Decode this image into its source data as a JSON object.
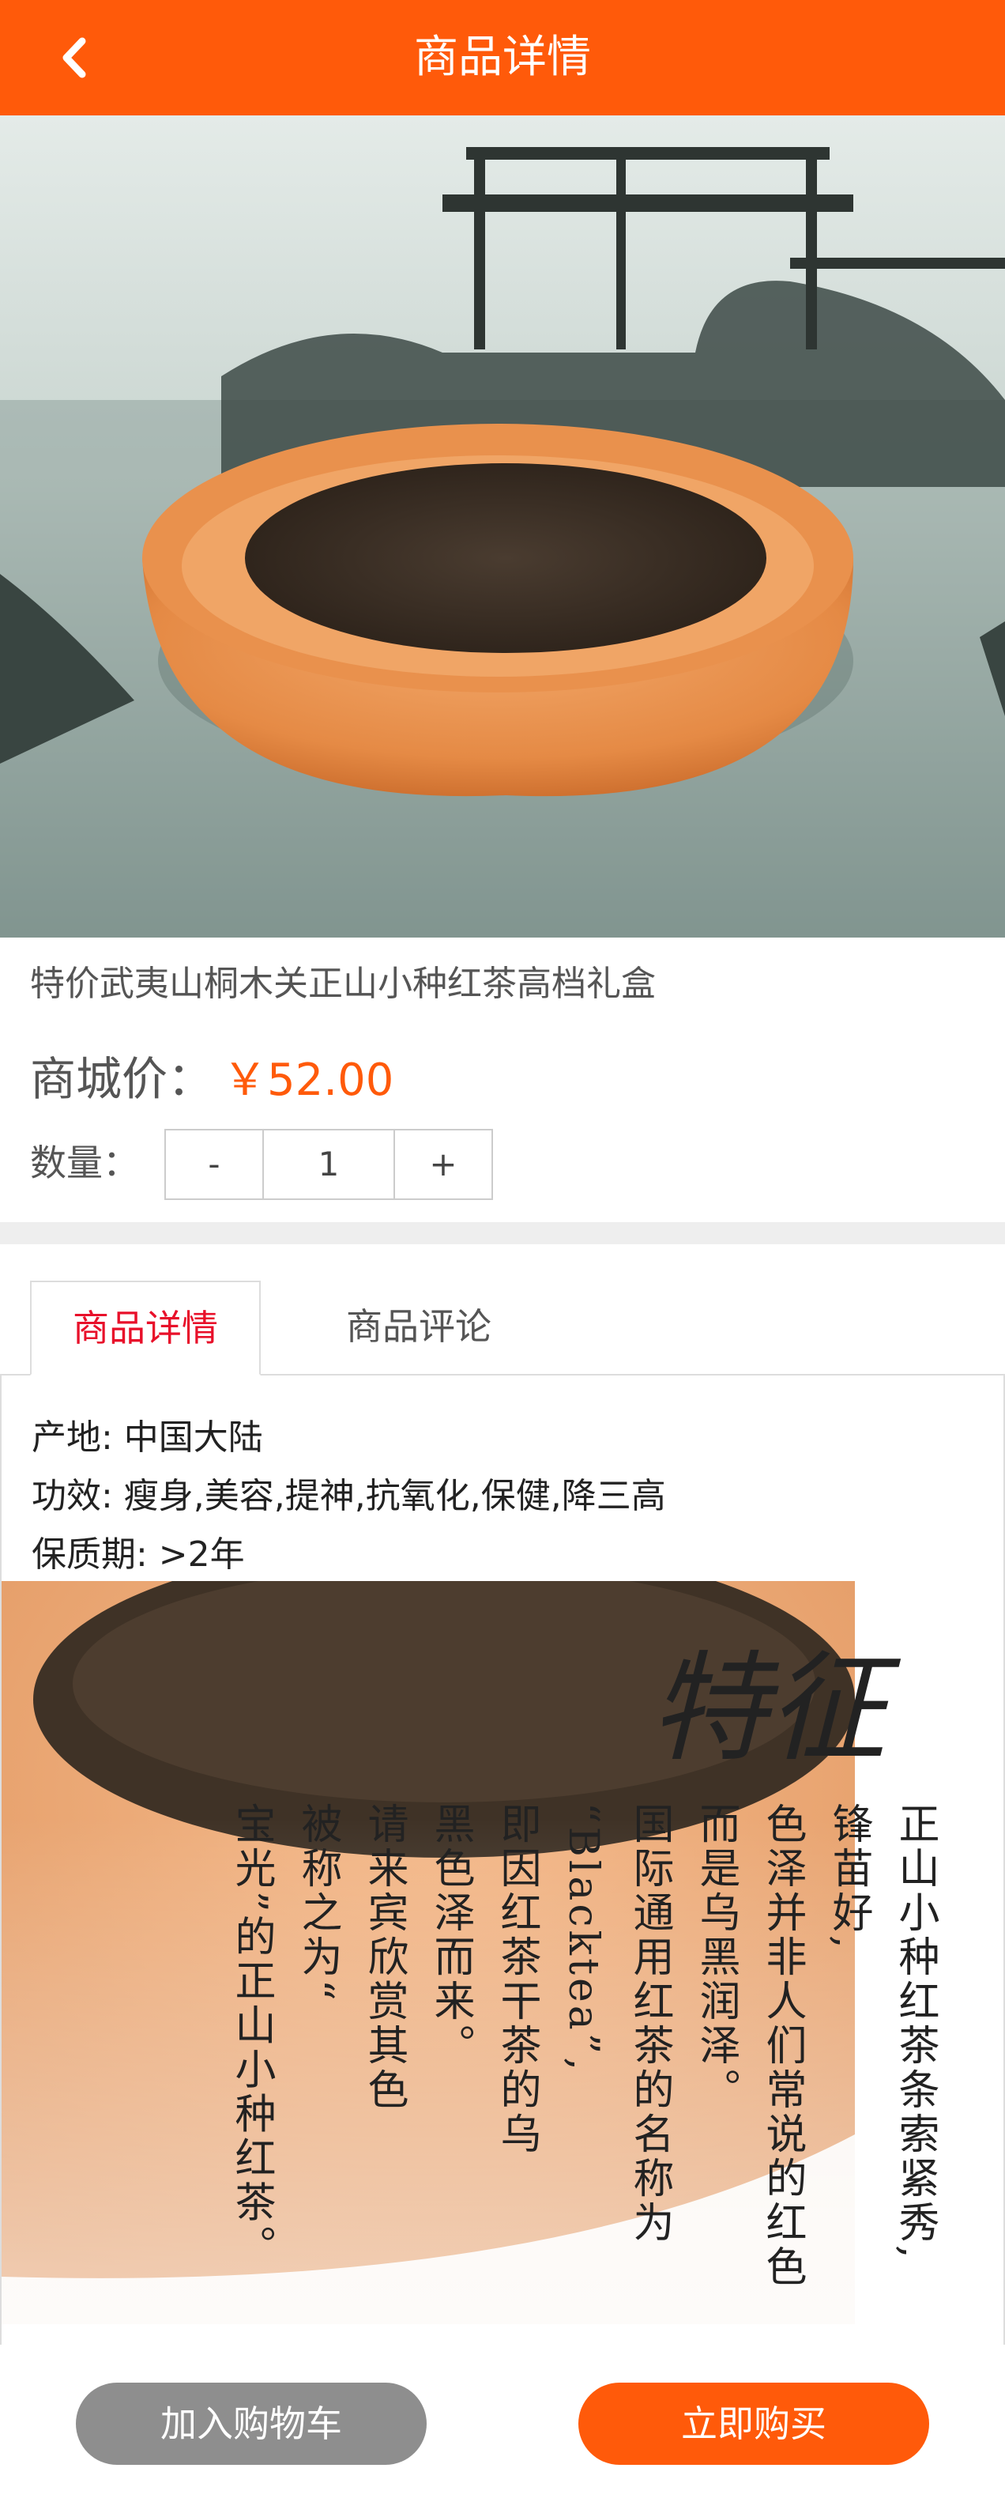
{
  "header": {
    "title": "商品详情",
    "back_icon": "chevron-left-icon"
  },
  "banner": {
    "slide_count": 2,
    "active_index": 1,
    "colors": {
      "dot": "#ffffff",
      "dot_active": "#f0a020"
    }
  },
  "product": {
    "title": "特价武夷山桐木关正山小种红茶高档礼盒",
    "price_label": "商城价：",
    "price_value": "￥52.00",
    "quantity_label": "数量：",
    "minus": "-",
    "quantity": "1",
    "plus": "+"
  },
  "tabs": [
    {
      "label": "商品详情",
      "active": true
    },
    {
      "label": "商品评论",
      "active": false
    }
  ],
  "specs": [
    "产地: 中国大陆",
    "功效: 瘦身,美容,提神,抗氧化,保健,降三高",
    "保质期: >2年"
  ],
  "detail_image": {
    "calligraphy": "特征",
    "columns": [
      "正山小种红茶条索紧秀,",
      "锋苗好,",
      "色泽并非人们常说的红色",
      "而是乌黑润泽。",
      "国际通用红茶的名称为",
      "“Blacktea”,",
      "即因红茶干茶的乌",
      "黑色泽而来。",
      "请来宾欣赏其色",
      "被称之为“",
      "宝光”的正山小种红茶。"
    ]
  },
  "actions": {
    "add_to_cart": "加入购物车",
    "buy_now": "立即购买"
  },
  "colors": {
    "accent": "#ff5a0a",
    "tab_active": "#e8102a",
    "cart_button": "#8e8e8e"
  }
}
